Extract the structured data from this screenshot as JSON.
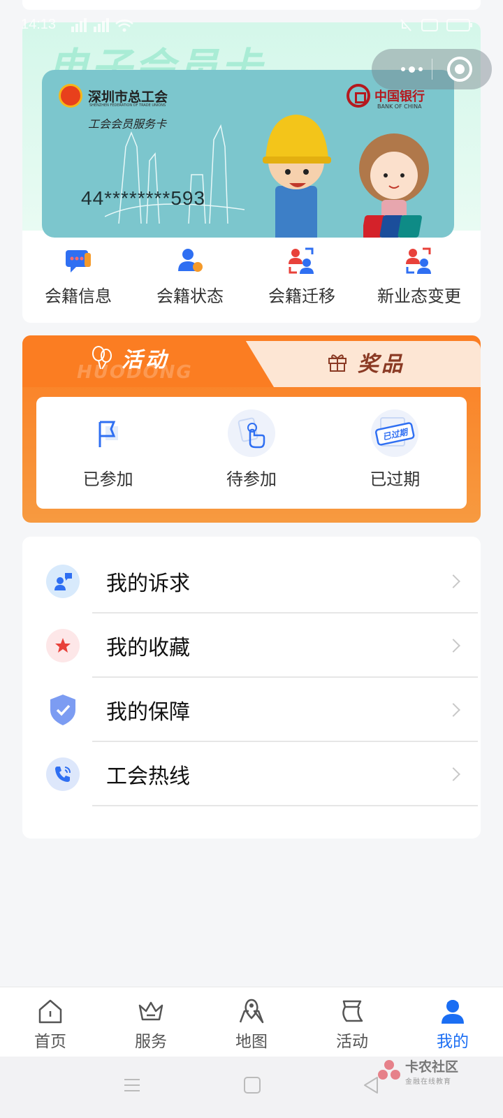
{
  "status_bar": {
    "time": "14:13",
    "left_icons": "signal-icons HD",
    "right_icons": "mute battery"
  },
  "banner": {
    "background_text": "电子会员卡"
  },
  "card": {
    "union_name": "深圳市总工会",
    "union_en": "SHENZHEN FEDERATION OF TRADE UNIONS",
    "card_type": "工会会员服务卡",
    "bank_name": "中国银行",
    "bank_en": "BANK OF CHINA",
    "card_number": "44********593"
  },
  "quick_actions": [
    {
      "label": "会籍信息",
      "icon": "chat-bubble-icon"
    },
    {
      "label": "会籍状态",
      "icon": "user-status-icon"
    },
    {
      "label": "会籍迁移",
      "icon": "transfer-icon"
    },
    {
      "label": "新业态变更",
      "icon": "user-change-icon"
    }
  ],
  "activity": {
    "tab_active": "活动",
    "tab_ghost": "HUODONG",
    "tab_other": "奖品",
    "items": [
      {
        "label": "已参加",
        "icon": "flag-icon"
      },
      {
        "label": "待参加",
        "icon": "tap-icon"
      },
      {
        "label": "已过期",
        "icon": "expired-stamp-icon",
        "stamp_text": "已过期"
      }
    ]
  },
  "menu": [
    {
      "label": "我的诉求",
      "icon": "appeal-icon"
    },
    {
      "label": "我的收藏",
      "icon": "star-icon"
    },
    {
      "label": "我的保障",
      "icon": "shield-check-icon"
    },
    {
      "label": "工会热线",
      "icon": "phone-icon"
    }
  ],
  "tabbar": [
    {
      "label": "首页",
      "icon": "home-icon",
      "active": false
    },
    {
      "label": "服务",
      "icon": "crown-icon",
      "active": false
    },
    {
      "label": "地图",
      "icon": "map-icon",
      "active": false
    },
    {
      "label": "活动",
      "icon": "activity-icon",
      "active": false
    },
    {
      "label": "我的",
      "icon": "profile-icon",
      "active": true
    }
  ],
  "watermark": {
    "title": "卡农社区",
    "subtitle": "金融在线教育"
  },
  "colors": {
    "accent_blue": "#1b6ef3",
    "activity_orange": "#fb7d22",
    "card_teal": "#7cc6cd"
  }
}
